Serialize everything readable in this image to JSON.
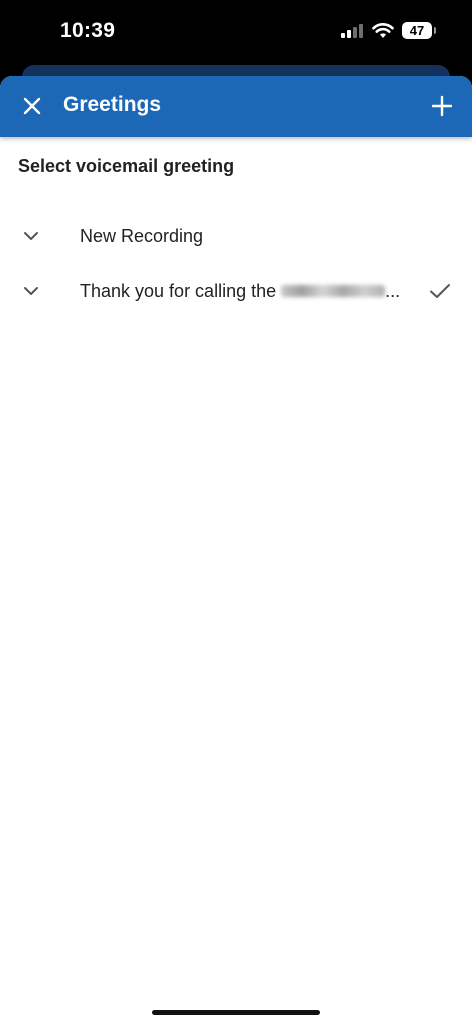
{
  "status_bar": {
    "time": "10:39",
    "battery_level": "47",
    "icons": [
      "signal-icon",
      "wifi-icon",
      "battery-icon"
    ]
  },
  "header": {
    "title": "Greetings",
    "close_icon": "close-icon",
    "add_icon": "plus-icon",
    "background_color": "#1d68b6"
  },
  "main": {
    "section_title": "Select voicemail greeting",
    "greetings": [
      {
        "label": "New Recording",
        "selected": false
      },
      {
        "label": "Thank you for calling the",
        "label_suffix": "...",
        "selected": true
      }
    ]
  }
}
